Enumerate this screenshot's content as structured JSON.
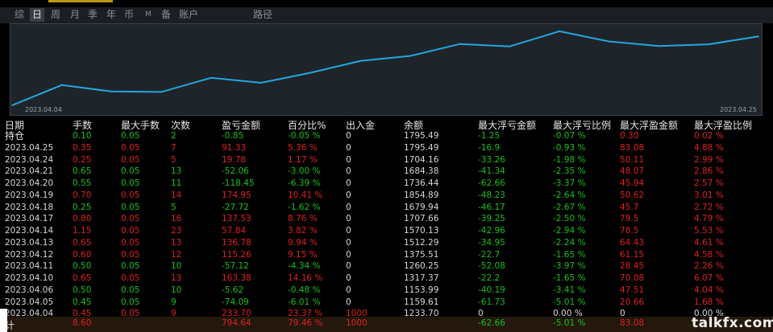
{
  "tabs": [
    {
      "label": "综",
      "active": false
    },
    {
      "label": "日",
      "active": true
    },
    {
      "label": "周",
      "active": false
    },
    {
      "label": "月",
      "active": false
    },
    {
      "label": "季",
      "active": false
    },
    {
      "label": "年",
      "active": false
    },
    {
      "label": "币",
      "active": false
    },
    {
      "label": "M",
      "active": false
    },
    {
      "label": "备",
      "active": false
    },
    {
      "label": "账户",
      "active": false
    },
    {
      "label": "路径",
      "active": false
    }
  ],
  "chart_data": {
    "type": "line",
    "x": [
      "2023.04.04",
      "2023.04.05",
      "2023.04.06",
      "2023.04.10",
      "2023.04.11",
      "2023.04.12",
      "2023.04.13",
      "2023.04.14",
      "2023.04.17",
      "2023.04.18",
      "2023.04.19",
      "2023.04.20",
      "2023.04.21",
      "2023.04.24",
      "2023.04.25"
    ],
    "y": [
      1233.7,
      1159.61,
      1153.99,
      1317.37,
      1260.25,
      1375.51,
      1512.29,
      1570.13,
      1707.66,
      1679.94,
      1854.89,
      1736.44,
      1684.38,
      1704.16,
      1795.49
    ],
    "x_start_label": "2023.04.04",
    "x_end_label": "2023.04.25",
    "line_color": "#22a7e0"
  },
  "table": {
    "headers": [
      "日期",
      "手数",
      "最大手数",
      "次数",
      "盈亏金额",
      "百分比%",
      "出入金",
      "余额",
      "最大浮亏金额",
      "最大浮亏比例",
      "最大浮盈金额",
      "最大浮盈比例"
    ],
    "rows": [
      {
        "c": [
          "持仓",
          "0.10",
          "0.05",
          "2",
          "-0.85",
          "-0.05 %",
          "0",
          "1795.49",
          "-1.25",
          "-0.07 %",
          "0.30",
          "0.02 %"
        ],
        "s": [
          "n",
          "g",
          "g",
          "g",
          "g",
          "g",
          "n",
          "n",
          "g",
          "g",
          "r",
          "r"
        ]
      },
      {
        "c": [
          "2023.04.25",
          "0.35",
          "0.05",
          "7",
          "91.33",
          "5.36 %",
          "0",
          "1795.49",
          "-16.9",
          "-0.93 %",
          "83.08",
          "4.88 %"
        ],
        "s": [
          "n",
          "r",
          "r",
          "r",
          "r",
          "r",
          "n",
          "n",
          "g",
          "g",
          "r",
          "r"
        ]
      },
      {
        "c": [
          "2023.04.24",
          "0.25",
          "0.05",
          "5",
          "19.78",
          "1.17 %",
          "0",
          "1704.16",
          "-33.26",
          "-1.98 %",
          "50.11",
          "2.99 %"
        ],
        "s": [
          "n",
          "r",
          "r",
          "r",
          "r",
          "r",
          "n",
          "n",
          "g",
          "g",
          "r",
          "r"
        ]
      },
      {
        "c": [
          "2023.04.21",
          "0.65",
          "0.05",
          "13",
          "-52.06",
          "-3.00 %",
          "0",
          "1684.38",
          "-41.34",
          "-2.35 %",
          "48.07",
          "2.86 %"
        ],
        "s": [
          "n",
          "g",
          "g",
          "g",
          "g",
          "g",
          "n",
          "n",
          "g",
          "g",
          "r",
          "r"
        ]
      },
      {
        "c": [
          "2023.04.20",
          "0.55",
          "0.05",
          "11",
          "-118.45",
          "-6.39 %",
          "0",
          "1736.44",
          "-62.66",
          "-3.37 %",
          "45.94",
          "2.57 %"
        ],
        "s": [
          "n",
          "g",
          "g",
          "g",
          "g",
          "g",
          "n",
          "n",
          "g",
          "g",
          "r",
          "r"
        ]
      },
      {
        "c": [
          "2023.04.19",
          "0.70",
          "0.05",
          "14",
          "174.95",
          "10.41 %",
          "0",
          "1854.89",
          "-48.23",
          "-2.64 %",
          "50.62",
          "3.01 %"
        ],
        "s": [
          "n",
          "r",
          "r",
          "r",
          "r",
          "r",
          "n",
          "n",
          "g",
          "g",
          "r",
          "r"
        ]
      },
      {
        "c": [
          "2023.04.18",
          "0.25",
          "0.05",
          "5",
          "-27.72",
          "-1.62 %",
          "0",
          "1679.94",
          "-46.17",
          "-2.67 %",
          "45.7",
          "2.72 %"
        ],
        "s": [
          "n",
          "g",
          "g",
          "g",
          "g",
          "g",
          "n",
          "n",
          "g",
          "g",
          "r",
          "r"
        ]
      },
      {
        "c": [
          "2023.04.17",
          "0.80",
          "0.05",
          "16",
          "137.53",
          "8.76 %",
          "0",
          "1707.66",
          "-39.25",
          "-2.50 %",
          "79.5",
          "4.79 %"
        ],
        "s": [
          "n",
          "r",
          "r",
          "r",
          "r",
          "r",
          "n",
          "n",
          "g",
          "g",
          "r",
          "r"
        ]
      },
      {
        "c": [
          "2023.04.14",
          "1.15",
          "0.05",
          "23",
          "57.84",
          "3.82 %",
          "0",
          "1570.13",
          "-42.96",
          "-2.94 %",
          "78.5",
          "5.53 %"
        ],
        "s": [
          "n",
          "r",
          "r",
          "r",
          "r",
          "r",
          "n",
          "n",
          "g",
          "g",
          "r",
          "r"
        ]
      },
      {
        "c": [
          "2023.04.13",
          "0.65",
          "0.05",
          "13",
          "136.78",
          "9.94 %",
          "0",
          "1512.29",
          "-34.95",
          "-2.24 %",
          "64.43",
          "4.61 %"
        ],
        "s": [
          "n",
          "r",
          "r",
          "r",
          "r",
          "r",
          "n",
          "n",
          "g",
          "g",
          "r",
          "r"
        ]
      },
      {
        "c": [
          "2023.04.12",
          "0.60",
          "0.05",
          "12",
          "115.26",
          "9.15 %",
          "0",
          "1375.51",
          "-22.7",
          "-1.65 %",
          "61.15",
          "4.58 %"
        ],
        "s": [
          "n",
          "r",
          "r",
          "r",
          "r",
          "r",
          "n",
          "n",
          "g",
          "g",
          "r",
          "r"
        ]
      },
      {
        "c": [
          "2023.04.11",
          "0.50",
          "0.05",
          "10",
          "-57.12",
          "-4.34 %",
          "0",
          "1260.25",
          "-52.08",
          "-3.97 %",
          "28.45",
          "2.26 %"
        ],
        "s": [
          "n",
          "g",
          "g",
          "g",
          "g",
          "g",
          "n",
          "n",
          "g",
          "g",
          "r",
          "r"
        ]
      },
      {
        "c": [
          "2023.04.10",
          "0.65",
          "0.05",
          "13",
          "163.38",
          "14.16 %",
          "0",
          "1317.37",
          "-22.2",
          "-1.65 %",
          "70.08",
          "6.07 %"
        ],
        "s": [
          "n",
          "r",
          "r",
          "r",
          "r",
          "r",
          "n",
          "n",
          "g",
          "g",
          "r",
          "r"
        ]
      },
      {
        "c": [
          "2023.04.06",
          "0.50",
          "0.05",
          "10",
          "-5.62",
          "-0.48 %",
          "0",
          "1153.99",
          "-40.19",
          "-3.41 %",
          "47.51",
          "4.04 %"
        ],
        "s": [
          "n",
          "g",
          "g",
          "g",
          "g",
          "g",
          "n",
          "n",
          "g",
          "g",
          "r",
          "r"
        ]
      },
      {
        "c": [
          "2023.04.05",
          "0.45",
          "0.05",
          "9",
          "-74.09",
          "-6.01 %",
          "0",
          "1159.61",
          "-61.73",
          "-5.01 %",
          "20.66",
          "1.68 %"
        ],
        "s": [
          "n",
          "g",
          "g",
          "g",
          "g",
          "g",
          "n",
          "n",
          "g",
          "g",
          "r",
          "r"
        ]
      },
      {
        "c": [
          "2023.04.04",
          "0.45",
          "0.05",
          "9",
          "233.70",
          "23.37 %",
          "1000",
          "1233.70",
          "0",
          "0.00 %",
          "0",
          "0.00 %"
        ],
        "s": [
          "n",
          "r",
          "r",
          "r",
          "r",
          "r",
          "r",
          "n",
          "n",
          "n",
          "n",
          "n"
        ]
      }
    ],
    "summary": {
      "c": [
        "计",
        "8.60",
        "",
        "",
        "794.64",
        "79.46 %",
        "1000",
        "",
        "-62.66",
        "-5.01 %",
        "83.08",
        ""
      ],
      "s": [
        "n",
        "r",
        "n",
        "n",
        "r",
        "r",
        "r",
        "n",
        "g",
        "g",
        "r",
        "n"
      ]
    }
  },
  "watermark": "talkfx.com",
  "colors": {
    "pos": "#e02020",
    "neg": "#19c219",
    "neutral": "#d8d8d8"
  }
}
